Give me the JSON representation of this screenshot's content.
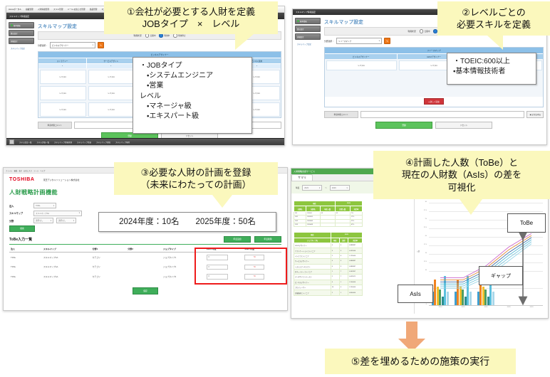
{
  "panel1": {
    "menubar": [
      "Homeポータル",
      "組織管理",
      "人財情報管理",
      "スキル管理",
      "メール・お知らせ管理",
      "商品管理",
      "マスタ管理",
      "システム管理"
    ],
    "titlebar": "スキルマップ情報設定",
    "sidebar": {
      "buttons": [
        "基本情報",
        "算出設定",
        "詳細設定"
      ],
      "link": "スキルマップ設定"
    },
    "page_title": "スキルマップ設定",
    "filter_label": "利用状況",
    "radios": [
      {
        "label": "公開中",
        "selected": false
      },
      {
        "label": "利用中",
        "selected": true
      },
      {
        "label": "利用停止",
        "selected": false
      }
    ],
    "select_label": "分野選択：",
    "select_value": "ビジネスデザイナー",
    "orange_button": "✎",
    "grid_header": "ビジネスデザイナー",
    "columns": [
      "ストラテジー",
      "サービスデザイン",
      "マーケティング",
      "ビジネス開発",
      "ビジネス運用"
    ],
    "col_marks": [
      "*",
      "*",
      "*",
      "*",
      "*"
    ],
    "cells": "レベル1",
    "comment_label": "申請内容コメント",
    "comment_value": "",
    "submit_label": "登録",
    "reset_label": "リセット",
    "taskbar": [
      "スキル設定一覧",
      "スキル評価一覧",
      "スキルマップ情報管理",
      "スキルマップ登録",
      "スキルマップ参照",
      "スキルマップ削除"
    ]
  },
  "panel2": {
    "titlebar": "スキルマップ情報設定",
    "sidebar": {
      "buttons": [
        "基本情報",
        "算出設定",
        "詳細設定"
      ],
      "link": "スキルマップ設定"
    },
    "page_title": "スキルマップ設定",
    "filter_label": "利用状況",
    "radios": [
      {
        "label": "公開中",
        "selected": false
      },
      {
        "label": "利用中",
        "selected": true
      },
      {
        "label": "利用停止",
        "selected": false
      }
    ],
    "select_label": "分野選択：",
    "select_value": "リソースマップ",
    "orange_button": "✎",
    "grid_header": "リソースマップ",
    "columns": [
      "ビジネスデザイナー",
      "UI/UXデザイナー",
      "データサイエンティスト"
    ],
    "cells": "レベル1",
    "red_button": "● 新しく追加",
    "comment_label": "申請内容コメント",
    "comment_value": "",
    "side_button": "▣ 定型文呼出",
    "submit_label": "登録",
    "reset_label": "リセット"
  },
  "panel3": {
    "topbar": [
      "ファイル",
      "編集",
      "表示",
      "お気に入り",
      "ツール",
      "ヘルプ"
    ],
    "brand": "TOSHIBA",
    "company": "東芝デジタルソリューション株式会社",
    "heading": "人財戦略計画機能",
    "form": [
      {
        "label": "法人",
        "value": "TDSL"
      },
      {
        "label": "スキルマップ",
        "value": "スキルマップAA"
      },
      {
        "label": "分野",
        "value": "選択なし",
        "value2": "選択なし"
      }
    ],
    "search_label": "検索",
    "section_title": "ToBe入力一覧",
    "top_buttons": [
      "年度追加",
      "年度削除"
    ],
    "table": {
      "headers": [
        "法人",
        "スキルマップ",
        "分野1",
        "分野2",
        "ジョブタイプ",
        "2024 年度",
        "2025 年度"
      ],
      "rows": [
        {
          "cells": [
            "TDSL",
            "スキルマップAA",
            "カテゴリ",
            "",
            "ジョブタイプ1"
          ],
          "y2024": "0",
          "y2025": "50"
        },
        {
          "cells": [
            "TDSL",
            "スキルマップAA",
            "カテゴリ",
            "",
            "ジョブタイプ2"
          ],
          "y2024": "0",
          "y2025": "50"
        },
        {
          "cells": [
            "TDSL",
            "スキルマップAA",
            "カテゴリ",
            "",
            "ジョブタイプ3"
          ],
          "y2024": "0",
          "y2025": "50"
        }
      ]
    },
    "save_label": "保存"
  },
  "panel4": {
    "header_title": "人財戦略支援サービス",
    "tab": "サマリ",
    "filter_label": "年度",
    "filter_from": "2023",
    "filter_to": "2029",
    "filter_sep": "〜",
    "table1": {
      "group_headers": [
        "現在",
        "2029"
      ],
      "headers": [
        "分野名",
        "分野名",
        "現在人数",
        "目標人数",
        "充足率"
      ],
      "rows": [
        [
          "DX",
          "DX001",
          "52",
          "52",
          "7%"
        ],
        [
          "DX1",
          "DX0261",
          "",
          "",
          "17%"
        ],
        [
          "DX2",
          "DX0362",
          "",
          "",
          "27%"
        ],
        [
          "DX3",
          "DX0463",
          "",
          "",
          "67%"
        ]
      ]
    },
    "table2": {
      "group_headers": [
        "現在",
        "2029"
      ],
      "headers": [
        "ジョブタイプ名",
        "現在",
        "目標",
        "充足率"
      ],
      "rows": [
        [
          "UI/UXデザイナー",
          "4",
          "4",
          "0.888887"
        ],
        [
          "アプリケーションエンジニア",
          "3",
          "3",
          "0.555556"
        ],
        [
          "インフラエンジニア",
          "2",
          "4",
          "1.125000"
        ],
        [
          "サービスデザイナー",
          "4",
          "3",
          "0.888887"
        ],
        [
          "システムアーキテクト",
          "4",
          "3",
          "0.888887"
        ],
        [
          "セキュリティエンジニア",
          "1",
          "7",
          "0.562857"
        ],
        [
          "データサイエンティスト",
          "2",
          "7",
          "0.629571"
        ],
        [
          "ビジネスデザイナー",
          "4",
          "1",
          "1.200000"
        ],
        [
          "プロデューサー",
          "10",
          "4",
          "1.250000"
        ],
        [
          "先端技術エンジニア",
          "2",
          "1",
          "0.800000"
        ]
      ]
    },
    "chart_annotations": {
      "tobe": "ToBe",
      "gap": "ギャップ",
      "asis": "AsIs"
    }
  },
  "chart_data": {
    "type": "bar",
    "title": "",
    "xlabel": "",
    "ylabel": "人数",
    "ylim": [
      0,
      30
    ],
    "yticks": [
      0,
      5,
      10,
      12.5,
      15,
      17.5,
      20,
      22.5,
      25,
      27.5,
      30
    ],
    "ytick_labels": [
      "0",
      "5",
      "10",
      "12.5",
      "15",
      "17.5",
      "20",
      "22.5",
      "25",
      "27.5",
      "30"
    ],
    "categories": [
      "2024",
      "2025",
      "2026",
      "2028",
      "2029"
    ],
    "grid": true,
    "legend_position": "none",
    "series": [
      {
        "name": "UI/UXデザイナー",
        "type": "bar",
        "color": "#3f9fd0",
        "values": [
          4.0,
          4.0,
          4.0,
          0,
          0
        ]
      },
      {
        "name": "アプリケーションエンジニア",
        "type": "bar",
        "color": "#f0821e",
        "values": [
          7.5,
          7.5,
          7.5,
          0,
          0
        ]
      },
      {
        "name": "インフラエンジニア",
        "type": "bar",
        "color": "#f2c12e",
        "values": [
          5.5,
          5.5,
          5.5,
          0,
          0
        ]
      },
      {
        "name": "サービスデザイナー",
        "type": "bar",
        "color": "#4f9e63",
        "values": [
          4.5,
          4.5,
          4.5,
          0,
          0
        ]
      },
      {
        "name": "システムアーキテクト",
        "type": "bar",
        "color": "#2e8f8f",
        "values": [
          2.5,
          2.5,
          2.5,
          0,
          0
        ]
      },
      {
        "name": "セキュリティエンジニア",
        "type": "bar",
        "color": "#5bc0de",
        "values": [
          8.5,
          8.5,
          8.5,
          0,
          0
        ]
      },
      {
        "name": "データサイエンティスト",
        "type": "bar",
        "color": "#aad8ea",
        "values": [
          4.0,
          4.0,
          4.0,
          0,
          0
        ]
      },
      {
        "name": "ToBe-1",
        "type": "line",
        "color": "#cc66cc",
        "values": [
          8.0,
          8.0,
          11.5,
          17.0,
          21.0
        ]
      },
      {
        "name": "ToBe-2",
        "type": "line",
        "color": "#e08a3c",
        "values": [
          7.4,
          7.4,
          10.8,
          16.2,
          20.4
        ]
      },
      {
        "name": "ToBe-3",
        "type": "line",
        "color": "#3f6fa8",
        "values": [
          6.8,
          6.8,
          10.1,
          15.4,
          19.8
        ]
      },
      {
        "name": "ToBe-4",
        "type": "line",
        "color": "#5bb8d4",
        "values": [
          6.2,
          6.2,
          9.4,
          14.6,
          19.2
        ]
      },
      {
        "name": "ToBe-5",
        "type": "line",
        "color": "#7ec9df",
        "values": [
          5.6,
          5.6,
          8.7,
          13.8,
          18.6
        ]
      },
      {
        "name": "ToBe-6",
        "type": "line",
        "color": "#9ad6e8",
        "values": [
          5.0,
          5.0,
          8.0,
          13.0,
          18.0
        ]
      }
    ]
  },
  "callouts": {
    "c1": [
      "①会社が必要とする人財を定義",
      "JOBタイプ　×　レベル"
    ],
    "c2": [
      "②レベルごとの",
      "必要スキルを定義"
    ],
    "c3": [
      "③必要な人財の計画を登録",
      "（未来にわたっての計画）"
    ],
    "c4": [
      "④計画した人数（ToBe）と",
      "現在の人財数（AsIs）の差を",
      "可視化"
    ],
    "c5": [
      "⑤差を埋めるための施策の実行"
    ]
  },
  "notes": {
    "n1": [
      "・JOBタイプ",
      "　・システムエンジニア",
      "　・営業",
      "レベル",
      "　・マネージャ級",
      "　・エキスパート級"
    ],
    "n2": [
      "・TOEIC:600以上",
      "・基本情報技術者"
    ],
    "n3": [
      "2024年度：10名　　2025年度：50名"
    ]
  },
  "colors": {
    "callout_bg": "#fbf8bd",
    "arrow": "#f0a878",
    "highlight_red": "#ee1b1b",
    "brand_red": "#e2001a",
    "green": "#3fae5a",
    "blue_header": "#8cc0e8"
  }
}
